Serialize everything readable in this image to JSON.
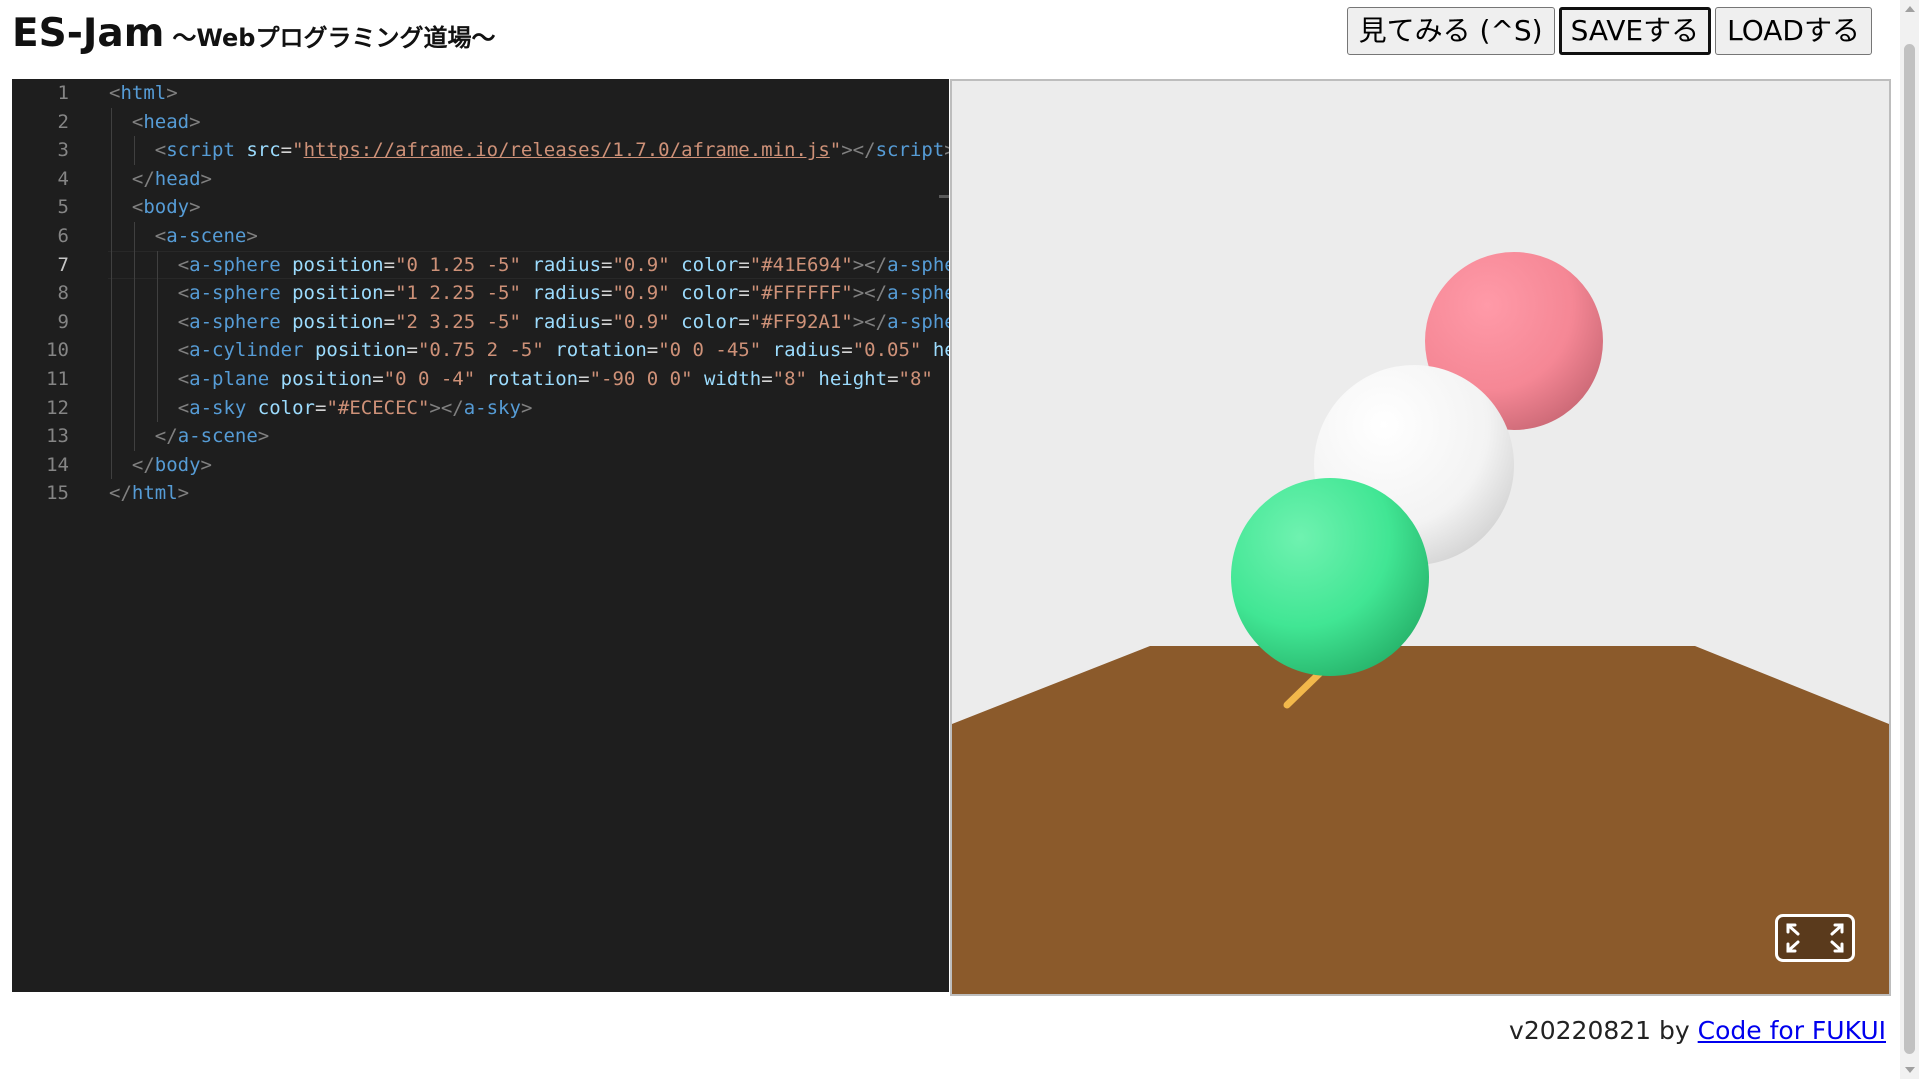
{
  "header": {
    "title": "ES-Jam",
    "subtitle": "～Webプログラミング道場～",
    "buttons": {
      "run": "見てみる (^S)",
      "save": "SAVEする",
      "load": "LOADする"
    }
  },
  "editor": {
    "active_line": 7,
    "lines": [
      {
        "n": "1",
        "indent": 0,
        "tokens": [
          [
            "br",
            "<"
          ],
          [
            "tag",
            "html"
          ],
          [
            "br",
            ">"
          ]
        ]
      },
      {
        "n": "2",
        "indent": 1,
        "tokens": [
          [
            "br",
            "<"
          ],
          [
            "tag",
            "head"
          ],
          [
            "br",
            ">"
          ]
        ]
      },
      {
        "n": "3",
        "indent": 2,
        "tokens": [
          [
            "br",
            "<"
          ],
          [
            "tag",
            "script"
          ],
          [
            "eq",
            " "
          ],
          [
            "attr",
            "src"
          ],
          [
            "eq",
            "="
          ],
          [
            "str",
            "\""
          ],
          [
            "url",
            "https://aframe.io/releases/1.7.0/aframe.min.js"
          ],
          [
            "str",
            "\""
          ],
          [
            "br",
            "></"
          ],
          [
            "tag",
            "script"
          ],
          [
            "br",
            ">"
          ]
        ]
      },
      {
        "n": "4",
        "indent": 1,
        "tokens": [
          [
            "br",
            "</"
          ],
          [
            "tag",
            "head"
          ],
          [
            "br",
            ">"
          ]
        ]
      },
      {
        "n": "5",
        "indent": 1,
        "tokens": [
          [
            "br",
            "<"
          ],
          [
            "tag",
            "body"
          ],
          [
            "br",
            ">"
          ]
        ]
      },
      {
        "n": "6",
        "indent": 2,
        "tokens": [
          [
            "br",
            "<"
          ],
          [
            "tag",
            "a-scene"
          ],
          [
            "br",
            ">"
          ]
        ]
      },
      {
        "n": "7",
        "indent": 3,
        "tokens": [
          [
            "br",
            "<"
          ],
          [
            "tag",
            "a-sphere"
          ],
          [
            "eq",
            " "
          ],
          [
            "attr",
            "position"
          ],
          [
            "eq",
            "="
          ],
          [
            "str",
            "\"0 1.25 -5\""
          ],
          [
            "eq",
            " "
          ],
          [
            "attr",
            "radius"
          ],
          [
            "eq",
            "="
          ],
          [
            "str",
            "\"0.9\""
          ],
          [
            "eq",
            " "
          ],
          [
            "attr",
            "color"
          ],
          [
            "eq",
            "="
          ],
          [
            "str",
            "\"#41E694\""
          ],
          [
            "br",
            "></"
          ],
          [
            "tag",
            "a-sphere"
          ],
          [
            "br",
            ">"
          ]
        ]
      },
      {
        "n": "8",
        "indent": 3,
        "tokens": [
          [
            "br",
            "<"
          ],
          [
            "tag",
            "a-sphere"
          ],
          [
            "eq",
            " "
          ],
          [
            "attr",
            "position"
          ],
          [
            "eq",
            "="
          ],
          [
            "str",
            "\"1 2.25 -5\""
          ],
          [
            "eq",
            " "
          ],
          [
            "attr",
            "radius"
          ],
          [
            "eq",
            "="
          ],
          [
            "str",
            "\"0.9\""
          ],
          [
            "eq",
            " "
          ],
          [
            "attr",
            "color"
          ],
          [
            "eq",
            "="
          ],
          [
            "str",
            "\"#FFFFFF\""
          ],
          [
            "br",
            "></"
          ],
          [
            "tag",
            "a-sphere"
          ],
          [
            "br",
            ">"
          ]
        ]
      },
      {
        "n": "9",
        "indent": 3,
        "tokens": [
          [
            "br",
            "<"
          ],
          [
            "tag",
            "a-sphere"
          ],
          [
            "eq",
            " "
          ],
          [
            "attr",
            "position"
          ],
          [
            "eq",
            "="
          ],
          [
            "str",
            "\"2 3.25 -5\""
          ],
          [
            "eq",
            " "
          ],
          [
            "attr",
            "radius"
          ],
          [
            "eq",
            "="
          ],
          [
            "str",
            "\"0.9\""
          ],
          [
            "eq",
            " "
          ],
          [
            "attr",
            "color"
          ],
          [
            "eq",
            "="
          ],
          [
            "str",
            "\"#FF92A1\""
          ],
          [
            "br",
            "></"
          ],
          [
            "tag",
            "a-sphere"
          ],
          [
            "br",
            ">"
          ]
        ]
      },
      {
        "n": "10",
        "indent": 3,
        "tokens": [
          [
            "br",
            "<"
          ],
          [
            "tag",
            "a-cylinder"
          ],
          [
            "eq",
            " "
          ],
          [
            "attr",
            "position"
          ],
          [
            "eq",
            "="
          ],
          [
            "str",
            "\"0.75 2 -5\""
          ],
          [
            "eq",
            " "
          ],
          [
            "attr",
            "rotation"
          ],
          [
            "eq",
            "="
          ],
          [
            "str",
            "\"0 0 -45\""
          ],
          [
            "eq",
            " "
          ],
          [
            "attr",
            "radius"
          ],
          [
            "eq",
            "="
          ],
          [
            "str",
            "\"0.05\""
          ],
          [
            "eq",
            " "
          ],
          [
            "attr",
            "height"
          ]
        ]
      },
      {
        "n": "11",
        "indent": 3,
        "tokens": [
          [
            "br",
            "<"
          ],
          [
            "tag",
            "a-plane"
          ],
          [
            "eq",
            " "
          ],
          [
            "attr",
            "position"
          ],
          [
            "eq",
            "="
          ],
          [
            "str",
            "\"0 0 -4\""
          ],
          [
            "eq",
            " "
          ],
          [
            "attr",
            "rotation"
          ],
          [
            "eq",
            "="
          ],
          [
            "str",
            "\"-90 0 0\""
          ],
          [
            "eq",
            " "
          ],
          [
            "attr",
            "width"
          ],
          [
            "eq",
            "="
          ],
          [
            "str",
            "\"8\""
          ],
          [
            "eq",
            " "
          ],
          [
            "attr",
            "height"
          ],
          [
            "eq",
            "="
          ],
          [
            "str",
            "\"8\""
          ]
        ]
      },
      {
        "n": "12",
        "indent": 3,
        "tokens": [
          [
            "br",
            "<"
          ],
          [
            "tag",
            "a-sky"
          ],
          [
            "eq",
            " "
          ],
          [
            "attr",
            "color"
          ],
          [
            "eq",
            "="
          ],
          [
            "str",
            "\"#ECECEC\""
          ],
          [
            "br",
            "></"
          ],
          [
            "tag",
            "a-sky"
          ],
          [
            "br",
            ">"
          ]
        ]
      },
      {
        "n": "13",
        "indent": 2,
        "tokens": [
          [
            "br",
            "</"
          ],
          [
            "tag",
            "a-scene"
          ],
          [
            "br",
            ">"
          ]
        ]
      },
      {
        "n": "14",
        "indent": 1,
        "tokens": [
          [
            "br",
            "</"
          ],
          [
            "tag",
            "body"
          ],
          [
            "br",
            ">"
          ]
        ]
      },
      {
        "n": "15",
        "indent": 0,
        "tokens": [
          [
            "br",
            "</"
          ],
          [
            "tag",
            "html"
          ],
          [
            "br",
            ">"
          ]
        ]
      }
    ]
  },
  "preview": {
    "sky_color": "#ECECEC",
    "ground_color": "#8B5A2B",
    "stick_color": "#F2B84B",
    "spheres": {
      "green": "#41E694",
      "white": "#FFFFFF",
      "pink": "#FF92A1"
    },
    "fullscreen_icon": "fullscreen-icon"
  },
  "footer": {
    "version": "v20220821 by ",
    "link_text": "Code for FUKUI"
  }
}
